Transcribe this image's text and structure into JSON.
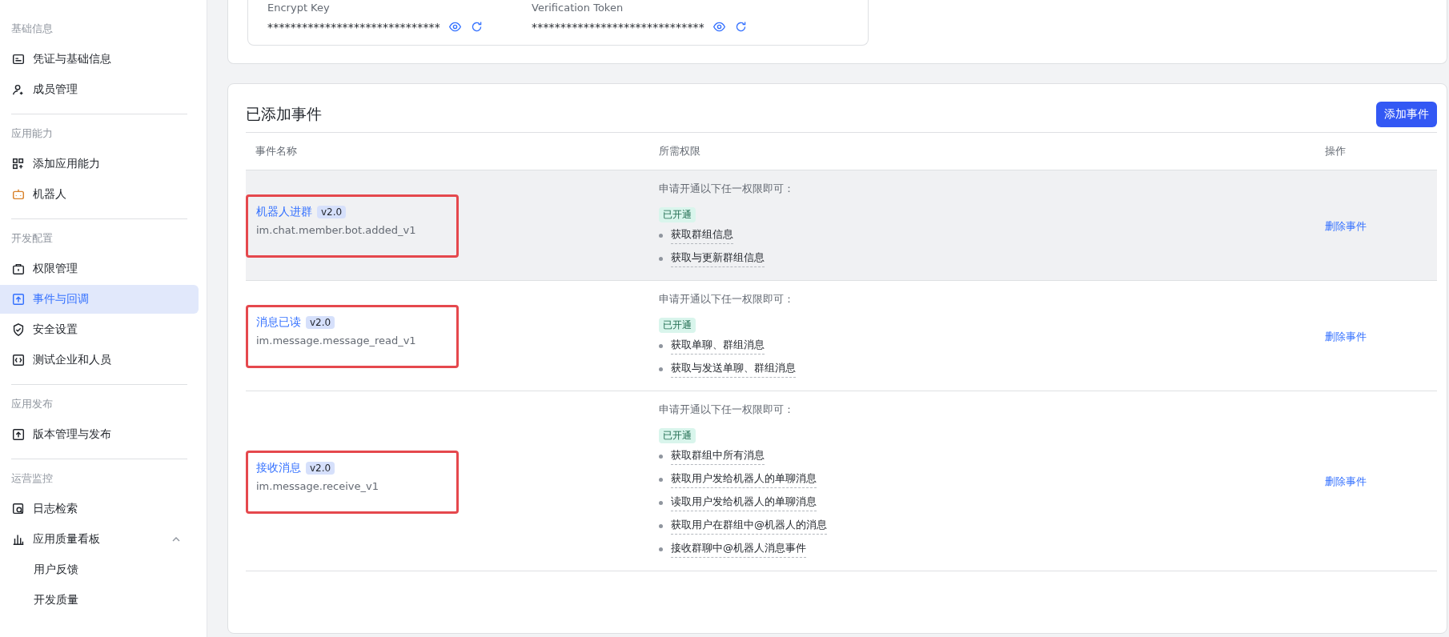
{
  "sidebar": {
    "groups": [
      {
        "label": "基础信息",
        "items": [
          {
            "label": "凭证与基础信息",
            "selected": false
          },
          {
            "label": "成员管理",
            "selected": false
          }
        ]
      },
      {
        "label": "应用能力",
        "items": [
          {
            "label": "添加应用能力",
            "selected": false
          },
          {
            "label": "机器人",
            "selected": false
          }
        ]
      },
      {
        "label": "开发配置",
        "items": [
          {
            "label": "权限管理",
            "selected": false
          },
          {
            "label": "事件与回调",
            "selected": true
          },
          {
            "label": "安全设置",
            "selected": false
          },
          {
            "label": "测试企业和人员",
            "selected": false
          }
        ]
      },
      {
        "label": "应用发布",
        "items": [
          {
            "label": "版本管理与发布",
            "selected": false
          }
        ]
      },
      {
        "label": "运营监控",
        "items": [
          {
            "label": "日志检索",
            "selected": false
          },
          {
            "label": "应用质量看板",
            "selected": false,
            "expanded": true,
            "children": [
              {
                "label": "用户反馈",
                "selected": false
              },
              {
                "label": "开发质量",
                "selected": false
              }
            ]
          }
        ]
      }
    ]
  },
  "credentials": [
    {
      "label": "Encrypt Key",
      "value": "******************************"
    },
    {
      "label": "Verification Token",
      "value": "******************************"
    }
  ],
  "events": {
    "title": "已添加事件",
    "add_button": "添加事件",
    "columns": [
      "事件名称",
      "所需权限",
      "操作"
    ],
    "rows": [
      {
        "name": "机器人进群",
        "version": "v2.0",
        "key": "im.chat.member.bot.added_v1",
        "hint": "申请开通以下任一权限即可：",
        "status": "已开通",
        "permissions": [
          "获取群组信息",
          "获取与更新群组信息"
        ],
        "action": "删除事件",
        "highlighted": true,
        "hovered": true
      },
      {
        "name": "消息已读",
        "version": "v2.0",
        "key": "im.message.message_read_v1",
        "hint": "申请开通以下任一权限即可：",
        "status": "已开通",
        "permissions": [
          "获取单聊、群组消息",
          "获取与发送单聊、群组消息"
        ],
        "action": "删除事件",
        "highlighted": true,
        "hovered": false
      },
      {
        "name": "接收消息",
        "version": "v2.0",
        "key": "im.message.receive_v1",
        "hint": "申请开通以下任一权限即可：",
        "status": "已开通",
        "permissions": [
          "获取群组中所有消息",
          "获取用户发给机器人的单聊消息",
          "读取用户发给机器人的单聊消息",
          "获取用户在群组中@机器人的消息",
          "接收群聊中@机器人消息事件"
        ],
        "action": "删除事件",
        "highlighted": true,
        "hovered": false
      }
    ]
  }
}
